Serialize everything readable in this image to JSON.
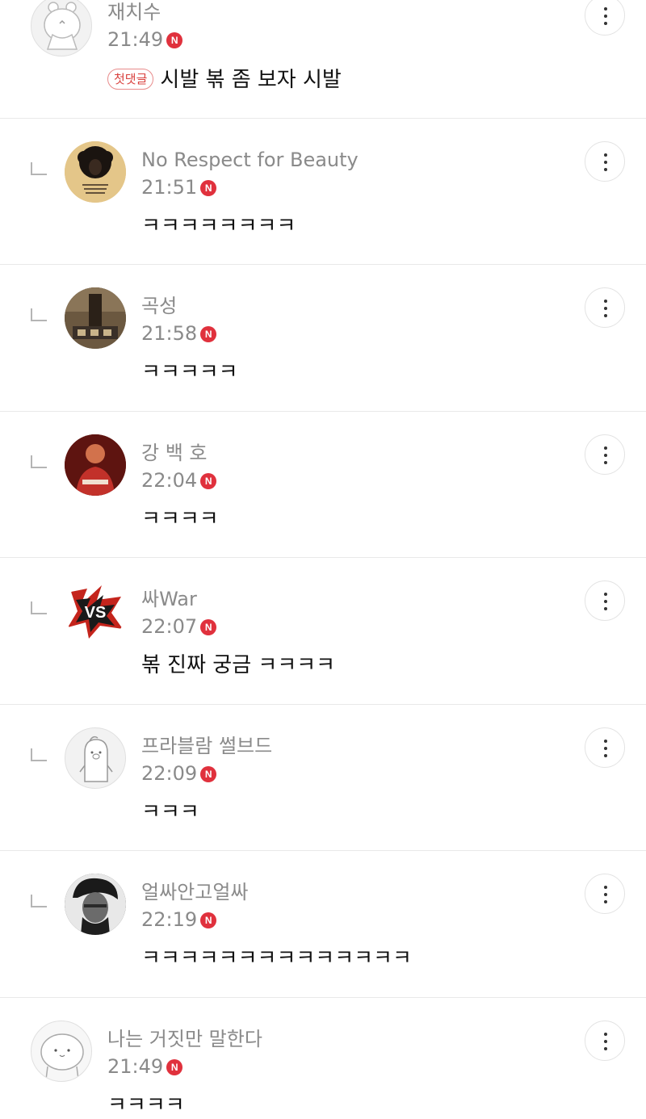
{
  "comments": [
    {
      "author": "재치수",
      "time": "21:49",
      "badge": "첫댓글",
      "text": "시발 볶 좀 보자 시발",
      "reply": false,
      "avatar_icon": "default-bear-avatar-icon"
    },
    {
      "author": "No Respect for Beauty",
      "time": "21:51",
      "text": "ㅋㅋㅋㅋㅋㅋㅋㅋ",
      "reply": true,
      "avatar_icon": "afro-portrait-avatar-icon"
    },
    {
      "author": "곡성",
      "time": "21:58",
      "text": "ㅋㅋㅋㅋㅋ",
      "reply": true,
      "avatar_icon": "photo-avatar-icon"
    },
    {
      "author": "강 백 호",
      "time": "22:04",
      "text": "ㅋㅋㅋㅋ",
      "reply": true,
      "avatar_icon": "basketball-player-avatar-icon"
    },
    {
      "author": "싸War",
      "time": "22:07",
      "text": "볶 진짜 궁금 ㅋㅋㅋㅋ",
      "reply": true,
      "avatar_icon": "vs-avatar-icon"
    },
    {
      "author": "프라블람 썰브드",
      "time": "22:09",
      "text": "ㅋㅋㅋ",
      "reply": true,
      "avatar_icon": "default-penguin-avatar-icon"
    },
    {
      "author": "얼싸안고얼싸",
      "time": "22:19",
      "text": "ㅋㅋㅋㅋㅋㅋㅋㅋㅋㅋㅋㅋㅋㅋ",
      "reply": true,
      "avatar_icon": "portrait-photo-avatar-icon"
    },
    {
      "author": "나는 거짓만 말한다",
      "time": "21:49",
      "text": "ㅋㅋㅋㅋ",
      "reply": false,
      "avatar_icon": "default-face-avatar-icon"
    }
  ],
  "new_badge": "N",
  "colors": {
    "new_badge": "#e0313d",
    "first_badge": "#d9413e",
    "meta_text": "#8a8a8a"
  }
}
